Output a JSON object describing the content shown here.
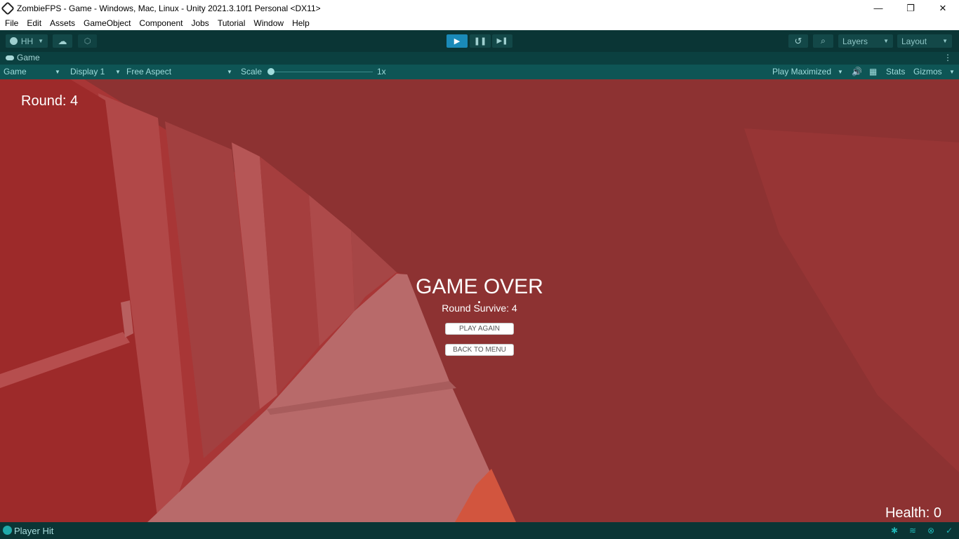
{
  "window": {
    "title": "ZombieFPS - Game - Windows, Mac, Linux - Unity 2021.3.10f1 Personal <DX11>",
    "controls": {
      "minimize": "—",
      "maximize": "❐",
      "close": "✕"
    }
  },
  "menu": [
    "File",
    "Edit",
    "Assets",
    "GameObject",
    "Component",
    "Jobs",
    "Tutorial",
    "Window",
    "Help"
  ],
  "toolbar": {
    "account_label": "HH",
    "play_icon": "play-icon",
    "pause_icon": "pause-icon",
    "step_icon": "step-icon",
    "layers_label": "Layers",
    "layout_label": "Layout"
  },
  "tab": {
    "label": "Game"
  },
  "game_toolbar": {
    "mode": "Game",
    "display": "Display 1",
    "aspect": "Free Aspect",
    "scale_label": "Scale",
    "scale_value": "1x",
    "play_mode": "Play Maximized",
    "stats": "Stats",
    "gizmos": "Gizmos"
  },
  "game": {
    "round_text": "Round: 4",
    "health_text": "Health: 0",
    "game_over_title": "GAME OVER",
    "round_survive_text": "Round Survive: 4",
    "play_again_label": "PLAY AGAIN",
    "back_to_menu_label": "BACK TO MENU"
  },
  "status_bar": {
    "message": "Player Hit"
  },
  "colors": {
    "toolbar_bg": "#0a3535",
    "game_toolbar_bg": "#0e5555",
    "play_active": "#1a8ab8",
    "game_tint": "#9a2a2a"
  }
}
